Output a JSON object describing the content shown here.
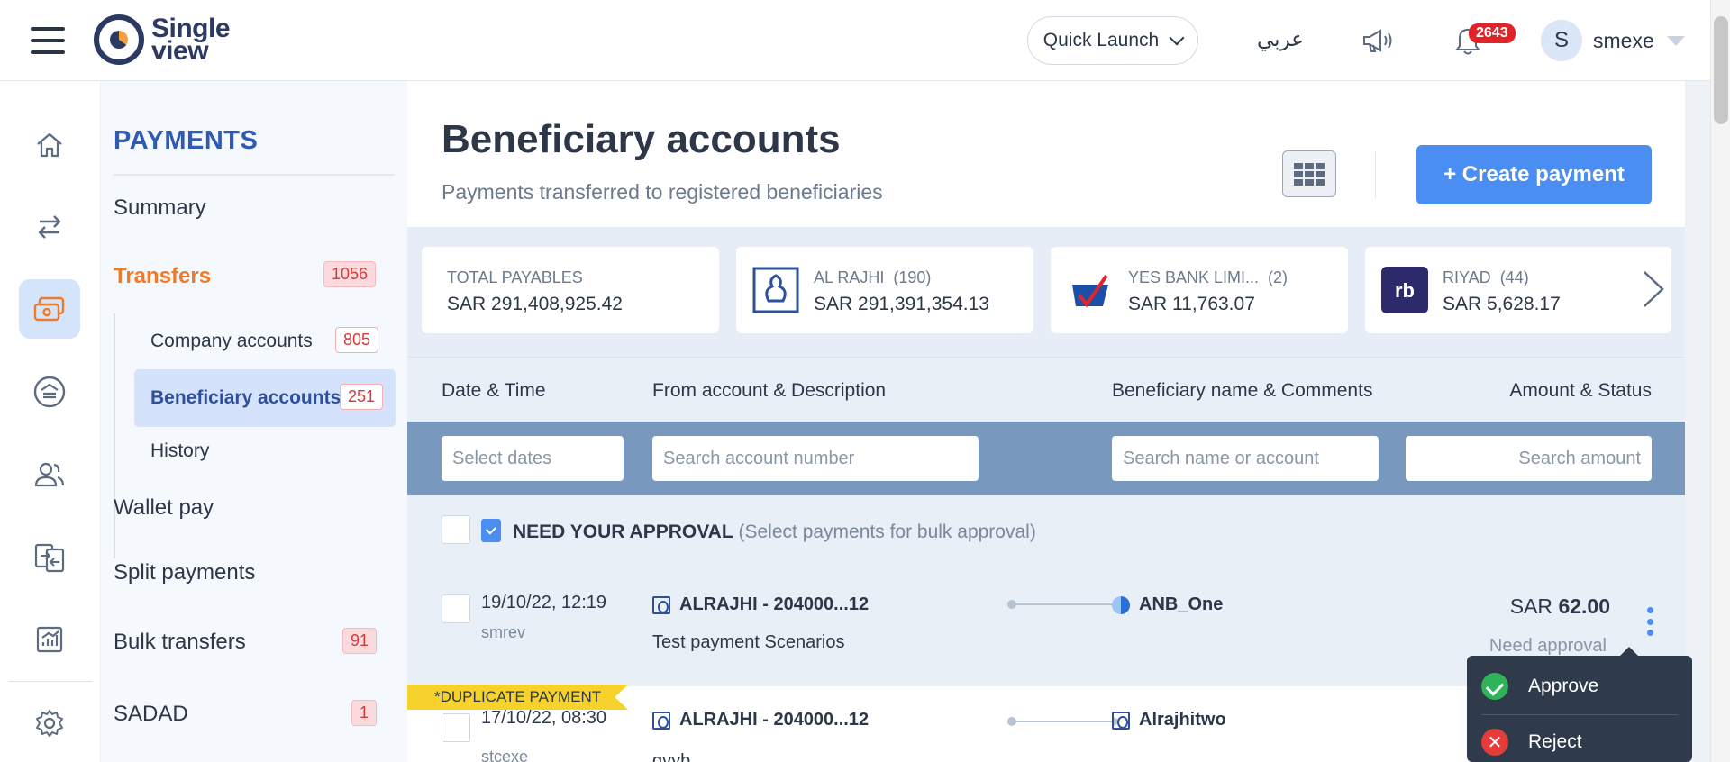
{
  "header": {
    "logo_line1": "Single",
    "logo_line2": "view",
    "quick_launch": "Quick Launch",
    "language": "عربي",
    "notifications_count": "2643",
    "avatar_initial": "S",
    "username": "smexe"
  },
  "rail": {
    "icons": [
      "home-icon",
      "transfer-arrows-icon",
      "payments-icon",
      "savings-icon",
      "users-icon",
      "document-exchange-icon",
      "reports-icon",
      "settings-icon"
    ],
    "active": "payments-icon"
  },
  "subnav": {
    "title": "PAYMENTS",
    "summary": "Summary",
    "transfers": "Transfers",
    "transfers_count": "1056",
    "company_accounts": "Company accounts",
    "company_accounts_count": "805",
    "beneficiary_accounts": "Beneficiary accounts",
    "beneficiary_accounts_count": "251",
    "history": "History",
    "wallet_pay": "Wallet pay",
    "split_payments": "Split payments",
    "bulk_transfers": "Bulk transfers",
    "bulk_transfers_count": "91",
    "sadad": "SADAD",
    "sadad_count": "1"
  },
  "page": {
    "title": "Beneficiary accounts",
    "subtitle": "Payments transferred to registered beneficiaries",
    "create_button": "+ Create payment"
  },
  "cards": [
    {
      "label": "TOTAL PAYABLES",
      "count": "",
      "value": "SAR  291,408,925.42"
    },
    {
      "label": "AL RAJHI",
      "count": "(190)",
      "value": "SAR  291,391,354.13"
    },
    {
      "label": "YES BANK LIMI...",
      "count": "(2)",
      "value": "SAR  11,763.07"
    },
    {
      "label": "RIYAD",
      "count": "(44)",
      "value": "SAR  5,628.17"
    }
  ],
  "table": {
    "col_date": "Date & Time",
    "col_from": "From account & Description",
    "col_bene": "Beneficiary name & Comments",
    "col_amount": "Amount & Status"
  },
  "filters": {
    "date_placeholder": "Select dates",
    "account_placeholder": "Search account number",
    "name_placeholder": "Search name or account",
    "amount_placeholder": "Search amount"
  },
  "approval": {
    "title": "NEED YOUR APPROVAL",
    "hint": "(Select payments for bulk approval)"
  },
  "rows": [
    {
      "datetime": "19/10/22, 12:19",
      "user": "smrev",
      "account": "ALRAJHI - 204000...12",
      "description": "Test payment Scenarios",
      "beneficiary": "ANB_One",
      "currency": "SAR",
      "amount": "62.00",
      "status": "Need approval"
    },
    {
      "ribbon": "*DUPLICATE PAYMENT",
      "datetime": "17/10/22, 08:30",
      "user": "stcexe",
      "account": "ALRAJHI - 204000...12",
      "description": "gvyb",
      "beneficiary": "Alrajhitwo"
    }
  ],
  "menu": {
    "approve": "Approve",
    "reject": "Reject"
  }
}
